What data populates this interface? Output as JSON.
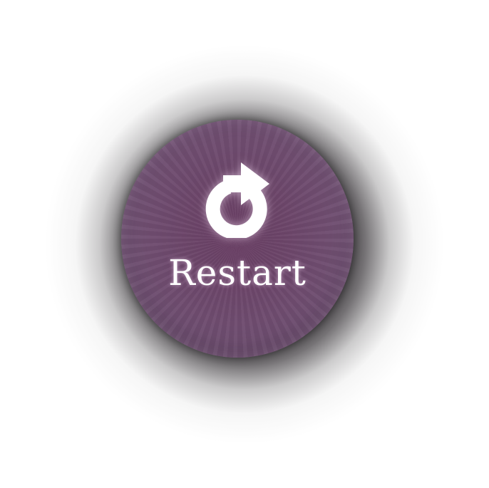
{
  "restart_button": {
    "label": "Restart",
    "icon": "restart-arrow-icon"
  },
  "colors": {
    "orb": "#6f4d70",
    "label": "#ffffff",
    "background": "#ffffff"
  }
}
